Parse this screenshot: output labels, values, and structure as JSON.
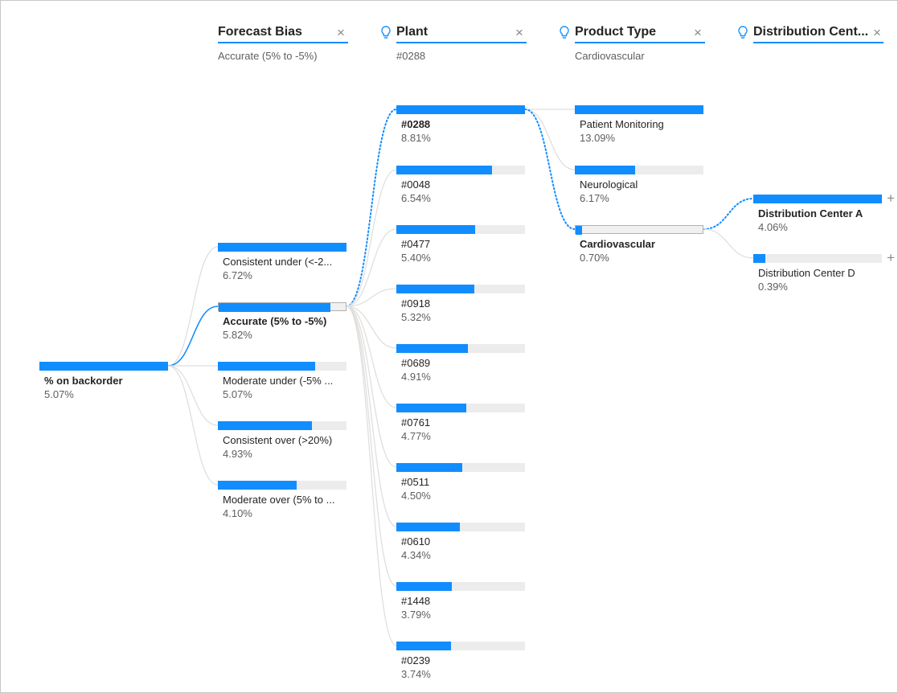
{
  "root": {
    "label": "% on backorder",
    "value": "5.07%",
    "fraction": 1.0
  },
  "levels": [
    {
      "title": "Forecast Bias",
      "filter": "Accurate (5% to -5%)",
      "ai_split": false,
      "nodes": [
        {
          "label": "Consistent under (<-2...",
          "value": "6.72%",
          "fraction": 1.0,
          "selected": false
        },
        {
          "label": "Accurate (5% to -5%)",
          "value": "5.82%",
          "fraction": 0.866,
          "selected": true
        },
        {
          "label": "Moderate under (-5% ...",
          "value": "5.07%",
          "fraction": 0.754,
          "selected": false
        },
        {
          "label": "Consistent over (>20%)",
          "value": "4.93%",
          "fraction": 0.734,
          "selected": false
        },
        {
          "label": "Moderate over (5% to ...",
          "value": "4.10%",
          "fraction": 0.61,
          "selected": false
        }
      ]
    },
    {
      "title": "Plant",
      "filter": "#0288",
      "ai_split": true,
      "nodes": [
        {
          "label": "#0288",
          "value": "8.81%",
          "fraction": 1.0,
          "selected": true
        },
        {
          "label": "#0048",
          "value": "6.54%",
          "fraction": 0.742,
          "selected": false
        },
        {
          "label": "#0477",
          "value": "5.40%",
          "fraction": 0.613,
          "selected": false
        },
        {
          "label": "#0918",
          "value": "5.32%",
          "fraction": 0.604,
          "selected": false
        },
        {
          "label": "#0689",
          "value": "4.91%",
          "fraction": 0.557,
          "selected": false
        },
        {
          "label": "#0761",
          "value": "4.77%",
          "fraction": 0.541,
          "selected": false
        },
        {
          "label": "#0511",
          "value": "4.50%",
          "fraction": 0.511,
          "selected": false
        },
        {
          "label": "#0610",
          "value": "4.34%",
          "fraction": 0.493,
          "selected": false
        },
        {
          "label": "#1448",
          "value": "3.79%",
          "fraction": 0.43,
          "selected": false
        },
        {
          "label": "#0239",
          "value": "3.74%",
          "fraction": 0.425,
          "selected": false
        }
      ]
    },
    {
      "title": "Product Type",
      "filter": "Cardiovascular",
      "ai_split": true,
      "nodes": [
        {
          "label": "Patient Monitoring",
          "value": "13.09%",
          "fraction": 1.0,
          "selected": false
        },
        {
          "label": "Neurological",
          "value": "6.17%",
          "fraction": 0.471,
          "selected": false
        },
        {
          "label": "Cardiovascular",
          "value": "0.70%",
          "fraction": 0.053,
          "selected": true
        }
      ]
    },
    {
      "title": "Distribution Cent...",
      "filter": "",
      "ai_split": true,
      "nodes": [
        {
          "label": "Distribution Center A",
          "value": "4.06%",
          "fraction": 1.0,
          "selected": true,
          "bold": true
        },
        {
          "label": "Distribution Center D",
          "value": "0.39%",
          "fraction": 0.096,
          "selected": false
        }
      ]
    }
  ],
  "colors": {
    "accent": "#118dff",
    "track": "#ececec",
    "link": "#e1dfdd",
    "text": "#252423",
    "subtle": "#605e5c"
  },
  "icons": {
    "close": "close-icon",
    "ai_split": "lightbulb-icon",
    "expand": "plus-icon"
  },
  "glyphs": {
    "close": "×",
    "plus": "+"
  }
}
